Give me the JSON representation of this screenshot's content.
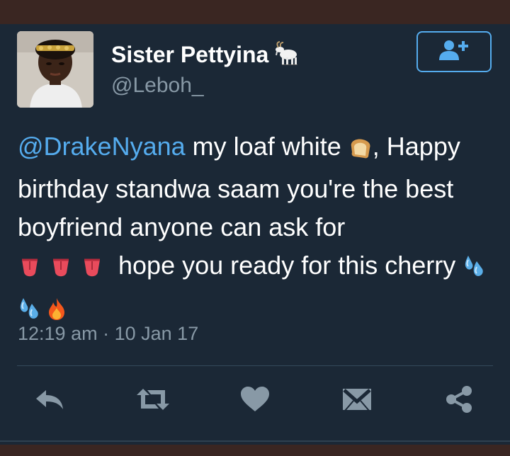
{
  "profile": {
    "display_name": "Sister Pettyina",
    "handle": "@Leboh_",
    "name_emoji": "goat-icon"
  },
  "follow_button": {
    "icon": "add-user-icon"
  },
  "tweet": {
    "mention": "@DrakeNyana",
    "text_part1": "my loaf white",
    "text_part2": ",",
    "text_part3": "Happy birthday standwa saam you're the best boyfriend anyone can ask for",
    "text_part4": "hope you ready for this cherry",
    "emojis": [
      "bread-icon",
      "tongue-icon",
      "tongue-icon",
      "tongue-icon",
      "sweat-droplets-icon",
      "sweat-droplets-icon",
      "fire-icon"
    ]
  },
  "timestamp": {
    "time": "12:19 am",
    "separator": "·",
    "date": "10 Jan 17"
  },
  "actions": [
    "reply-icon",
    "retweet-icon",
    "like-icon",
    "direct-message-icon",
    "share-icon"
  ],
  "colors": {
    "background": "#1b2836",
    "accent": "#55acee",
    "secondary_text": "#8899a6",
    "frame": "#3a2622"
  }
}
